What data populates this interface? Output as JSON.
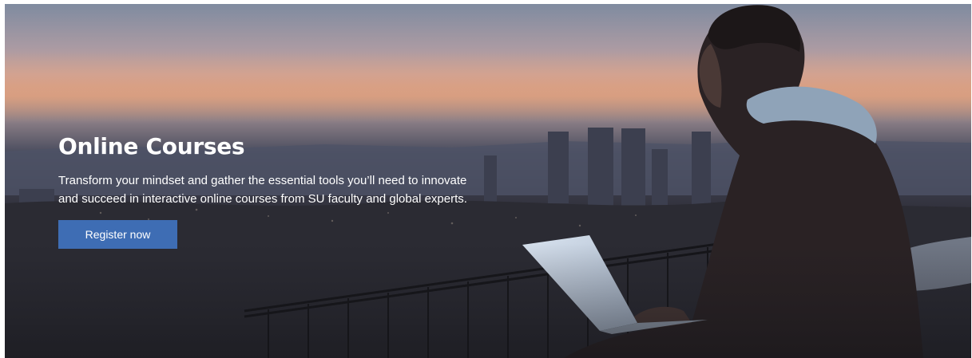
{
  "hero": {
    "title": "Online Courses",
    "description": "Transform your mindset and gather the essential tools you’ll need to innovate and succeed in interactive online courses from SU faculty and global experts.",
    "cta_label": "Register now"
  },
  "colors": {
    "cta_background": "#3e6db4",
    "text": "#ffffff"
  }
}
